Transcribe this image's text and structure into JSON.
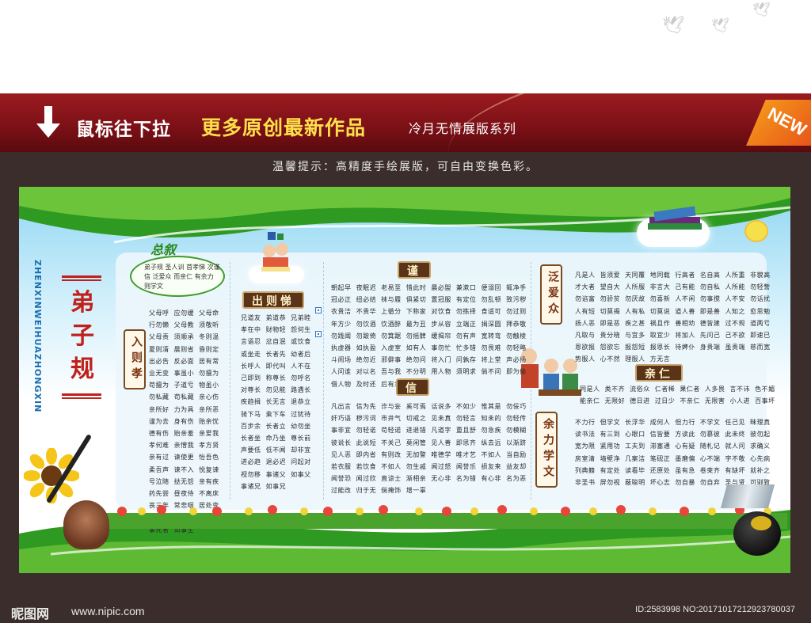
{
  "banner": {
    "lead": "鼠标往下拉",
    "main": "更多原创最新作品",
    "series": "冷月无情展版系列",
    "badge": "NEW"
  },
  "tip": "温馨提示：高精度手绘展版，可自由变换色彩。",
  "poster": {
    "pinyin": "ZHENXINWEIHUAZHONGXIN",
    "title": "弟子规",
    "zongxu": {
      "label": "总叙",
      "text": "弟子规  圣人训  首孝悌 次谨信  泛爱众  而亲仁 有余力  则学文"
    },
    "sections": {
      "ruxiao": "入则孝",
      "chuti": "出则悌",
      "jin": "谨",
      "xin": "信",
      "fanaizhong": "泛爱众",
      "qinren": "亲仁",
      "yulixuewen": "余力学文"
    },
    "columns": {
      "ruxiao": "父母呼  应勿缓  父母命\n行勿懒  父母教  须敬听\n父母责  须顺承  冬则温\n夏则凊  晨则省  昏则定\n出必告  反必面  居有常\n业无变  事虽小  勿擅为\n苟擅为  子道亏  物虽小\n勿私藏  苟私藏  亲心伤\n亲所好  力为具  亲所恶\n谨为去  身有伤  贻亲忧\n德有伤  贻亲羞  亲爱我\n孝何难  亲憎我  孝方贤\n亲有过  谏使更  怡吾色\n柔吾声  谏不入  悦复谏\n号泣随  挞无怨  亲有疾\n药先尝  昼夜侍  不离床\n丧三年  常悲咽  居处变\n酒肉绝  丧尽礼  祭尽诚\n事死者  如事生",
      "chuti": "兄道友  弟道恭  兄弟睦\n孝在中  财物轻  怨何生\n言语忍  忿自泯  或饮食\n或坐走  长者先  幼者后\n长呼人  即代叫  人不在\n己即到  称尊长  勿呼名\n对尊长  勿见能  路遇长\n疾趋揖  长无言  退恭立\n骑下马  乘下车  过犹待\n百步余  长者立  幼勿坐\n长者坐  命乃坐  尊长前\n声要低  低不闻  却非宜\n进必趋  退必迟  问起对\n视勿移  事诸父  如事父\n事诸兄  如事兄",
      "jin1": "朝起早  夜眠迟  老易至  惜此时  晨必盥  兼漱口  便溺回  辄净手\n冠必正  纽必结  袜与履  俱紧切  置冠服  有定位  勿乱顿  致污秽\n衣贵洁  不贵华  上循分  下称家  对饮食  勿拣择  食适可  勿过则\n年方少  勿饮酒  饮酒醉  最为丑  步从容  立端正  揖深圆  拜恭敬\n勿践阈  勿跛倚  勿箕踞  勿摇髀  缓揭帘  勿有声  宽转弯  勿触棱\n执虚器  如执盈  入虚室  如有人  事勿忙  忙多错  勿畏难  勿轻略\n斗闹场  绝勿近  邪僻事  绝勿问  将入门  问孰存  将上堂  声必扬\n人问谁  对以名  吾与我  不分明  用人物  须明求  倘不问  即为偷\n借人物  及时还  后有急  借不难",
      "xin1": "凡出言  信为先  诈与妄  奚可焉  话说多  不如少  惟其是  勿佞巧\n奸巧语  秽污词  市井气  切戒之  见未真  勿轻言  知未的  勿轻传\n事非宜  勿轻诺  苟轻诺  进退错  凡道字  重且舒  勿急疾  勿模糊\n彼说长  此说短  不关己  莫闲管  见人善  即思齐  纵去远  以渐跻\n见人恶  即内省  有则改  无加警  唯德学  唯才艺  不如人  当自励\n若衣服  若饮食  不如人  勿生戚  闻过怒  闻誉乐  损友来  益友却\n闻誉恐  闻过欣  直谅士  渐相亲  无心非  名为错  有心非  名为恶\n过能改  归于无  倘掩饰  增一辜",
      "fanai": "凡是人  皆须爱  天同覆  地同载  行高者  名自高  人所重  非貌高\n才大者  望自大  人所服  非言大  己有能  勿自私  人所能  勿轻訾\n勿谄富  勿骄贫  勿厌故  勿喜新  人不闲  勿事搅  人不安  勿话扰\n人有短  切莫揭  人有私  切莫说  道人善  即是善  人知之  愈思勉\n扬人恶  即是恶  疾之甚  祸且作  善相劝  德皆建  过不规  道两亏\n凡取与  贵分晓  与宜多  取宜少  将加人  先问己  己不欲  即速已\n恩欲报  怨欲忘  报怨短  报恩长  待婢仆  身贵端  虽贵端  慈而宽\n势服人  心不然  理服人  方无言",
      "qinren": "同是人  类不齐  流俗众  仁者稀  果仁者  人多畏  言不讳  色不媚\n能亲仁  无限好  德日进  过日少  不亲仁  无限害  小人进  百事坏",
      "xuewen": "不力行  但学文  长浮华  成何人  但力行  不学文  任己见  昧理真\n读书法  有三到  心眼口  信皆要  方读此  勿慕彼  此未终  彼勿起\n宽为限  紧用功  工夫到  滞塞通  心有疑  随札记  就人问  求确义\n房室清  墙壁净  几案洁  笔砚正  墨磨偏  心不端  字不敬  心先病\n列典籍  有定处  读看毕  还原处  虽有急  卷束齐  有缺坏  就补之\n非圣书  屏勿视  蔽聪明  坏心志  勿自暴  勿自弃  圣与贤  可驯致"
    }
  },
  "footer": {
    "logo": "昵图网",
    "url": "www.nipic.com",
    "id": "ID:2583998 NO:20171017212923780037"
  },
  "colors": {
    "banner_red": "#7a1016",
    "accent_yellow": "#ffe04a",
    "frame_dark": "#3b2d2b",
    "poster_green": "#3fa52a",
    "title_red": "#c0201a"
  }
}
